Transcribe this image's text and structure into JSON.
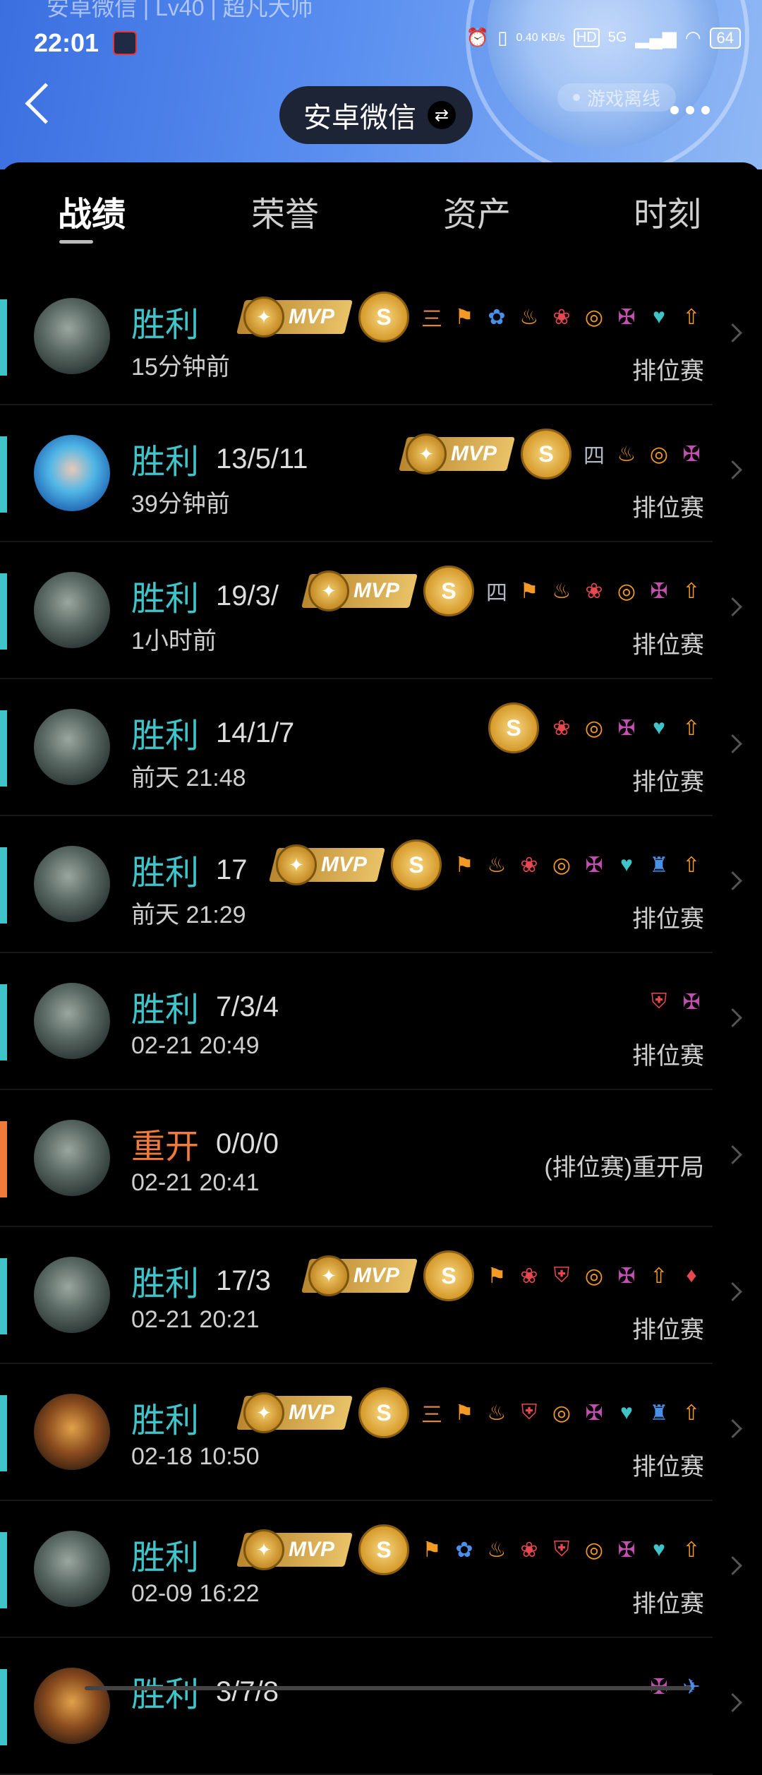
{
  "status_bar": {
    "top_subtitle": "安卓微信 | Lv40 | 超凡大师",
    "time": "22:01",
    "net_speed": "0.40 KB/s",
    "hd": "HD",
    "network": "5G",
    "battery": "64"
  },
  "header": {
    "account": "安卓微信",
    "swap_symbol": "⇄",
    "game_status": "游戏离线"
  },
  "tabs": [
    "战绩",
    "荣誉",
    "资产",
    "时刻"
  ],
  "colors": {
    "win": "#3fc4c9",
    "restart": "#f07a3a",
    "accent_header": "#3b6fe0"
  },
  "matches": [
    {
      "result": "胜利",
      "kda": "",
      "time": "15分钟前",
      "mode": "排位赛",
      "mvp": "MVP",
      "medal": "S",
      "icons": [
        "三",
        "⚑",
        "✿",
        "♨",
        "❀",
        "◎",
        "✠",
        "♥",
        "⇧"
      ]
    },
    {
      "result": "胜利",
      "kda": "13/5/11",
      "time": "39分钟前",
      "mode": "排位赛",
      "mvp": "MVP",
      "medal": "S",
      "icons": [
        "四",
        "♨",
        "◎",
        "✠"
      ]
    },
    {
      "result": "胜利",
      "kda": "19/3/",
      "time": "1小时前",
      "mode": "排位赛",
      "mvp": "MVP",
      "medal": "S",
      "icons": [
        "四",
        "⚑",
        "♨",
        "❀",
        "◎",
        "✠",
        "⇧"
      ]
    },
    {
      "result": "胜利",
      "kda": "14/1/7",
      "time": "前天 21:48",
      "mode": "排位赛",
      "mvp": "",
      "medal": "S",
      "icons": [
        "❀",
        "◎",
        "✠",
        "♥",
        "⇧"
      ]
    },
    {
      "result": "胜利",
      "kda": "17",
      "time": "前天 21:29",
      "mode": "排位赛",
      "mvp": "MVP",
      "medal": "S",
      "icons": [
        "⚑",
        "♨",
        "❀",
        "◎",
        "✠",
        "♥",
        "♜",
        "⇧"
      ]
    },
    {
      "result": "胜利",
      "kda": "7/3/4",
      "time": "02-21 20:49",
      "mode": "排位赛",
      "mvp": "",
      "medal": "",
      "icons": [
        "⛨",
        "✠"
      ]
    },
    {
      "result": "重开",
      "kda": "0/0/0",
      "time": "02-21 20:41",
      "mode": "(排位赛)重开局",
      "mvp": "",
      "medal": "",
      "icons": []
    },
    {
      "result": "胜利",
      "kda": "17/3",
      "time": "02-21 20:21",
      "mode": "排位赛",
      "mvp": "MVP",
      "medal": "S",
      "icons": [
        "⚑",
        "❀",
        "⛨",
        "◎",
        "✠",
        "⇧",
        "♦"
      ]
    },
    {
      "result": "胜利",
      "kda": "",
      "time": "02-18 10:50",
      "mode": "排位赛",
      "mvp": "MVP",
      "medal": "S",
      "icons": [
        "三",
        "⚑",
        "♨",
        "⛨",
        "◎",
        "✠",
        "♥",
        "♜",
        "⇧"
      ]
    },
    {
      "result": "胜利",
      "kda": "",
      "time": "02-09 16:22",
      "mode": "排位赛",
      "mvp": "MVP",
      "medal": "S",
      "icons": [
        "⚑",
        "✿",
        "♨",
        "❀",
        "⛨",
        "◎",
        "✠",
        "♥",
        "⇧"
      ]
    },
    {
      "result": "胜利",
      "kda": "3/7/8",
      "time": "",
      "mode": "",
      "mvp": "",
      "medal": "",
      "icons": [
        "✠",
        "✈"
      ]
    }
  ]
}
